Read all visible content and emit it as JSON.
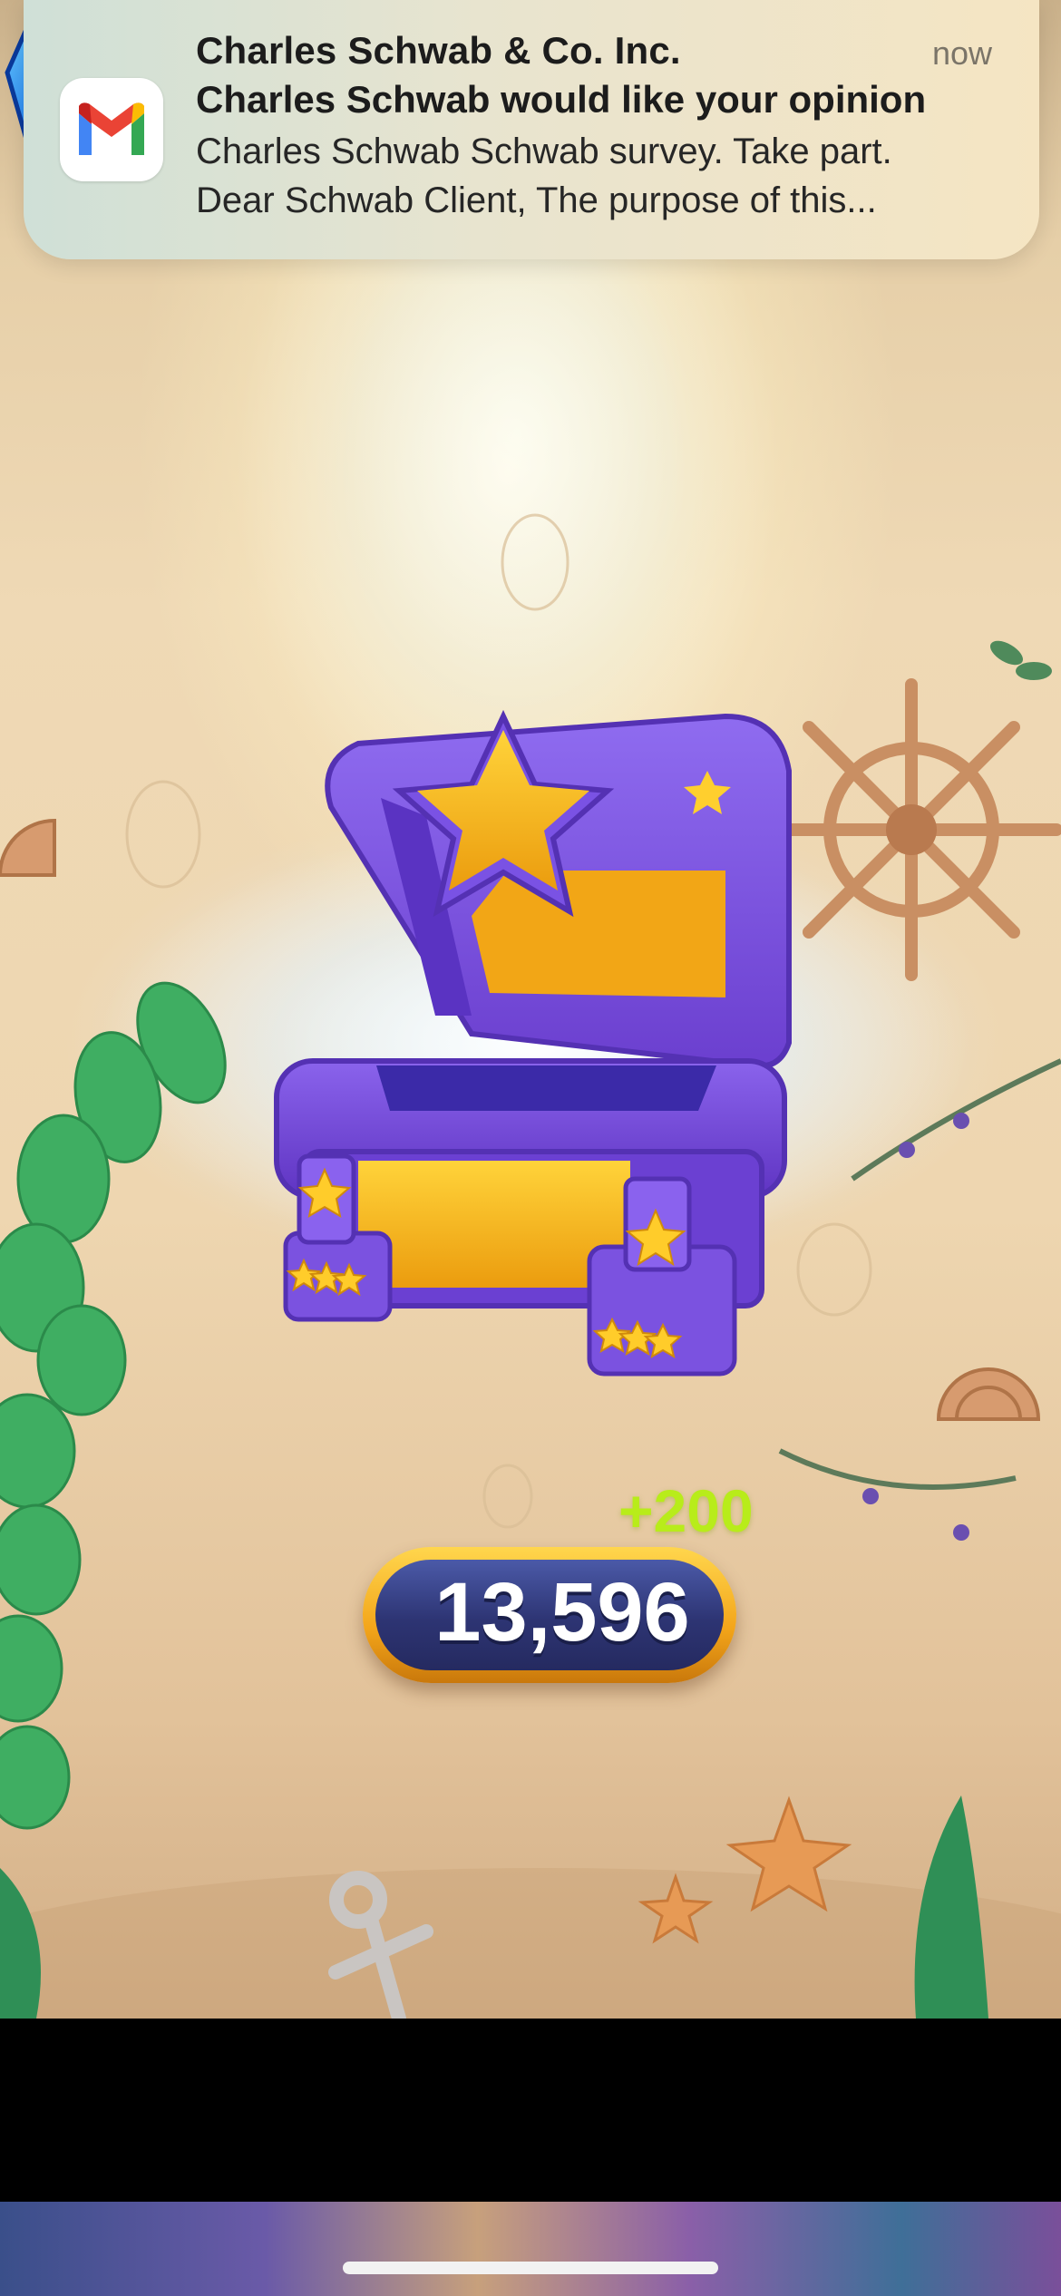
{
  "notification": {
    "app_icon": "gmail-icon",
    "sender": "Charles Schwab & Co. Inc.",
    "time": "now",
    "subject": "Charles Schwab would like your opinion",
    "body_line1": "Charles Schwab Schwab survey. Take part.",
    "body_line2": "Dear Schwab Client, The purpose of this..."
  },
  "game": {
    "reward_item": "treasure-chest-icon",
    "gem_icon": "blue-gem-icon",
    "gem_count": "13,596",
    "gem_bonus": "+200"
  },
  "colors": {
    "chest_purple": "#7a4fd6",
    "chest_gold": "#f6b81a",
    "bonus_green": "#b8ec1a",
    "counter_navy": "#2d3473"
  }
}
